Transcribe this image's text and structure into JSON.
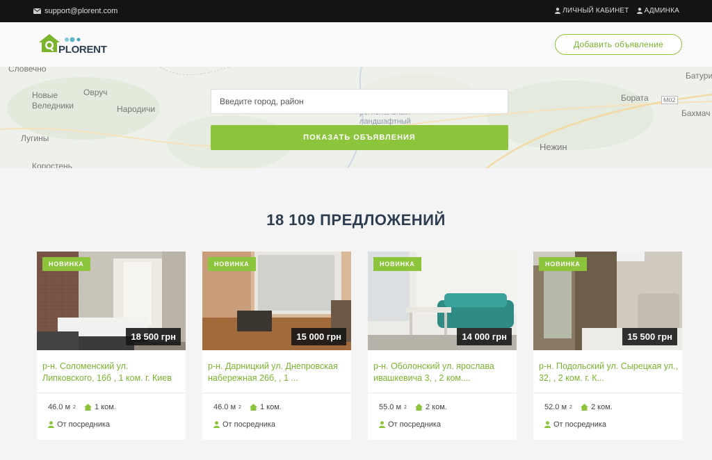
{
  "topbar": {
    "email": "support@plorent.com",
    "cabinet": "ЛИЧНЫЙ КАБИНЕТ",
    "admin": "АДМИНКА"
  },
  "header": {
    "logo_text": "PLORENT",
    "add_button": "Добавить объявление",
    "colors": {
      "accent": "#8cc43c",
      "dark": "#2c3e50"
    }
  },
  "hero": {
    "search_placeholder": "Введите город, район",
    "show_button": "ПОКАЗАТЬ ОБЪЯВЛЕНИЯ",
    "map_labels": [
      "Словечно",
      "Новые Веледники",
      "Овруч",
      "Народичи",
      "Лугины",
      "Коростень",
      "Бората",
      "Батури",
      "Бахмач",
      "М02",
      "Нежин",
      "региональный ландшафтный"
    ]
  },
  "listing_count": "18 109 ПРЕДЛОЖЕНИЙ",
  "listings": [
    {
      "badge": "НОВИНКА",
      "price": "18 500 грн",
      "title": "р-н. Соломенский ул. Липковского, 16б , 1 ком. г. Киев",
      "area": "46.0 м",
      "rooms": "1 ком.",
      "agent": "От посредника"
    },
    {
      "badge": "НОВИНКА",
      "price": "15 000 грн",
      "title": "р-н. Дарницкий ул. Днепровская набережная 26б, , 1 ...",
      "area": "46.0 м",
      "rooms": "1 ком.",
      "agent": "От посредника"
    },
    {
      "badge": "НОВИНКА",
      "price": "14 000 грн",
      "title": "р-н. Оболонский ул. ярослава ивашкевича 3, , 2 ком....",
      "area": "55.0 м",
      "rooms": "2 ком.",
      "agent": "От посредника"
    },
    {
      "badge": "НОВИНКА",
      "price": "15 500 грн",
      "title": "р-н. Подольский ул. Сырецкая ул., 32, , 2 ком. г. К...",
      "area": "52.0 м",
      "rooms": "2 ком.",
      "agent": "От посредника"
    }
  ],
  "area_unit_sup": "2"
}
